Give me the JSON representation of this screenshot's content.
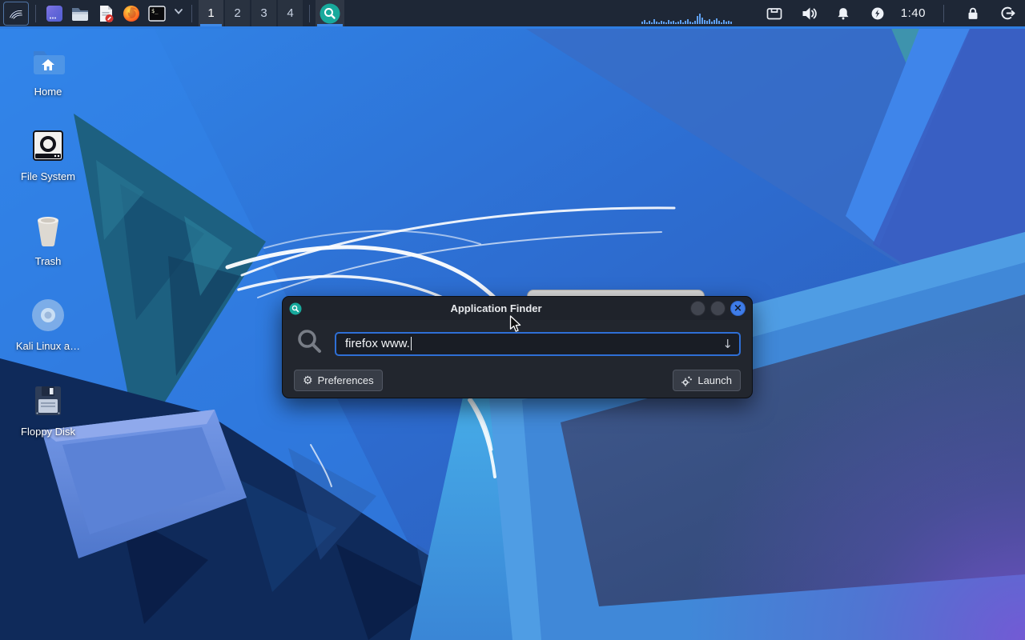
{
  "colors": {
    "accent": "#2f7ce0",
    "panel_bg": "#1e2736",
    "finder_teal": "#18a99c",
    "close_blue": "#3e7ce8",
    "dialog_bg": "#22262e"
  },
  "icons": {
    "gear": "⚙",
    "close": "×",
    "input_dropdown": "↓"
  },
  "panel": {
    "workspaces": [
      {
        "label": "1",
        "active": true
      },
      {
        "label": "2",
        "active": false
      },
      {
        "label": "3",
        "active": false
      },
      {
        "label": "4",
        "active": false
      }
    ],
    "terminal_glyph": "$_",
    "clock": "1:40",
    "graph_bars": [
      3,
      5,
      2,
      4,
      2,
      6,
      3,
      2,
      4,
      3,
      2,
      5,
      3,
      4,
      2,
      3,
      5,
      2,
      4,
      6,
      3,
      2,
      4,
      10,
      13,
      8,
      5,
      4,
      6,
      3,
      5,
      7,
      4,
      2,
      5,
      3,
      4,
      3
    ]
  },
  "desktop": {
    "icons": [
      {
        "label": "Home"
      },
      {
        "label": "File System"
      },
      {
        "label": "Trash"
      },
      {
        "label": "Kali Linux a…"
      },
      {
        "label": "Floppy Disk"
      }
    ]
  },
  "finder": {
    "title": "Application Finder",
    "query": "firefox www.",
    "buttons": {
      "preferences": "Preferences",
      "launch": "Launch"
    }
  }
}
